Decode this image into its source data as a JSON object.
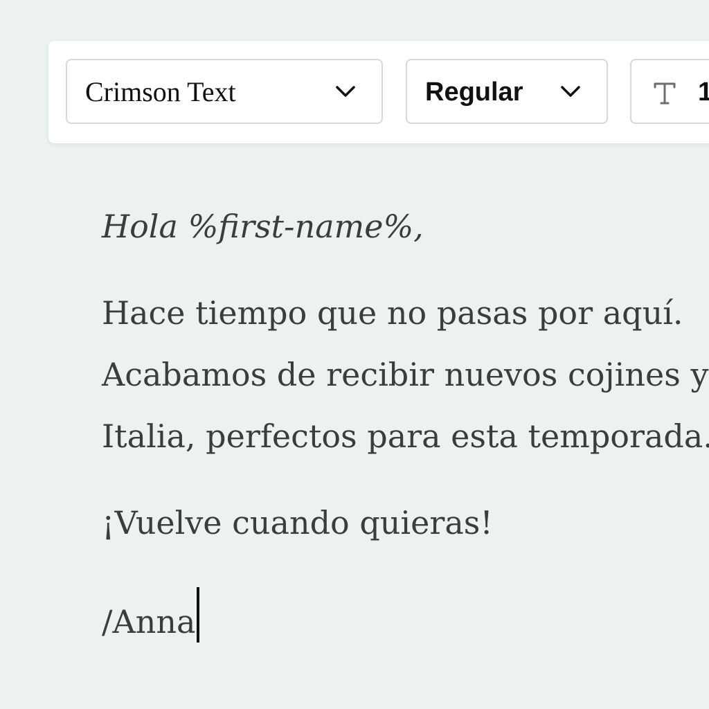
{
  "toolbar": {
    "font_family": {
      "value": "Crimson Text",
      "icon": "chevron-down-icon"
    },
    "font_weight": {
      "value": "Regular",
      "icon": "chevron-down-icon"
    },
    "font_size": {
      "icon": "text-size-icon",
      "value_partial": "1"
    }
  },
  "editor": {
    "greeting": "Hola %first-name%,",
    "body_lines": [
      "Hace tiempo que no pasas por aquí.",
      "Acabamos de recibir nuevos cojines y",
      "Italia, perfectos para esta temporada."
    ],
    "closing": "¡Vuelve cuando quieras!",
    "signature": "/Anna"
  },
  "colors": {
    "background": "#ecf2f1",
    "text": "#3b3d3d",
    "toolbar_bg": "#ffffff",
    "border": "#d6d9da"
  }
}
